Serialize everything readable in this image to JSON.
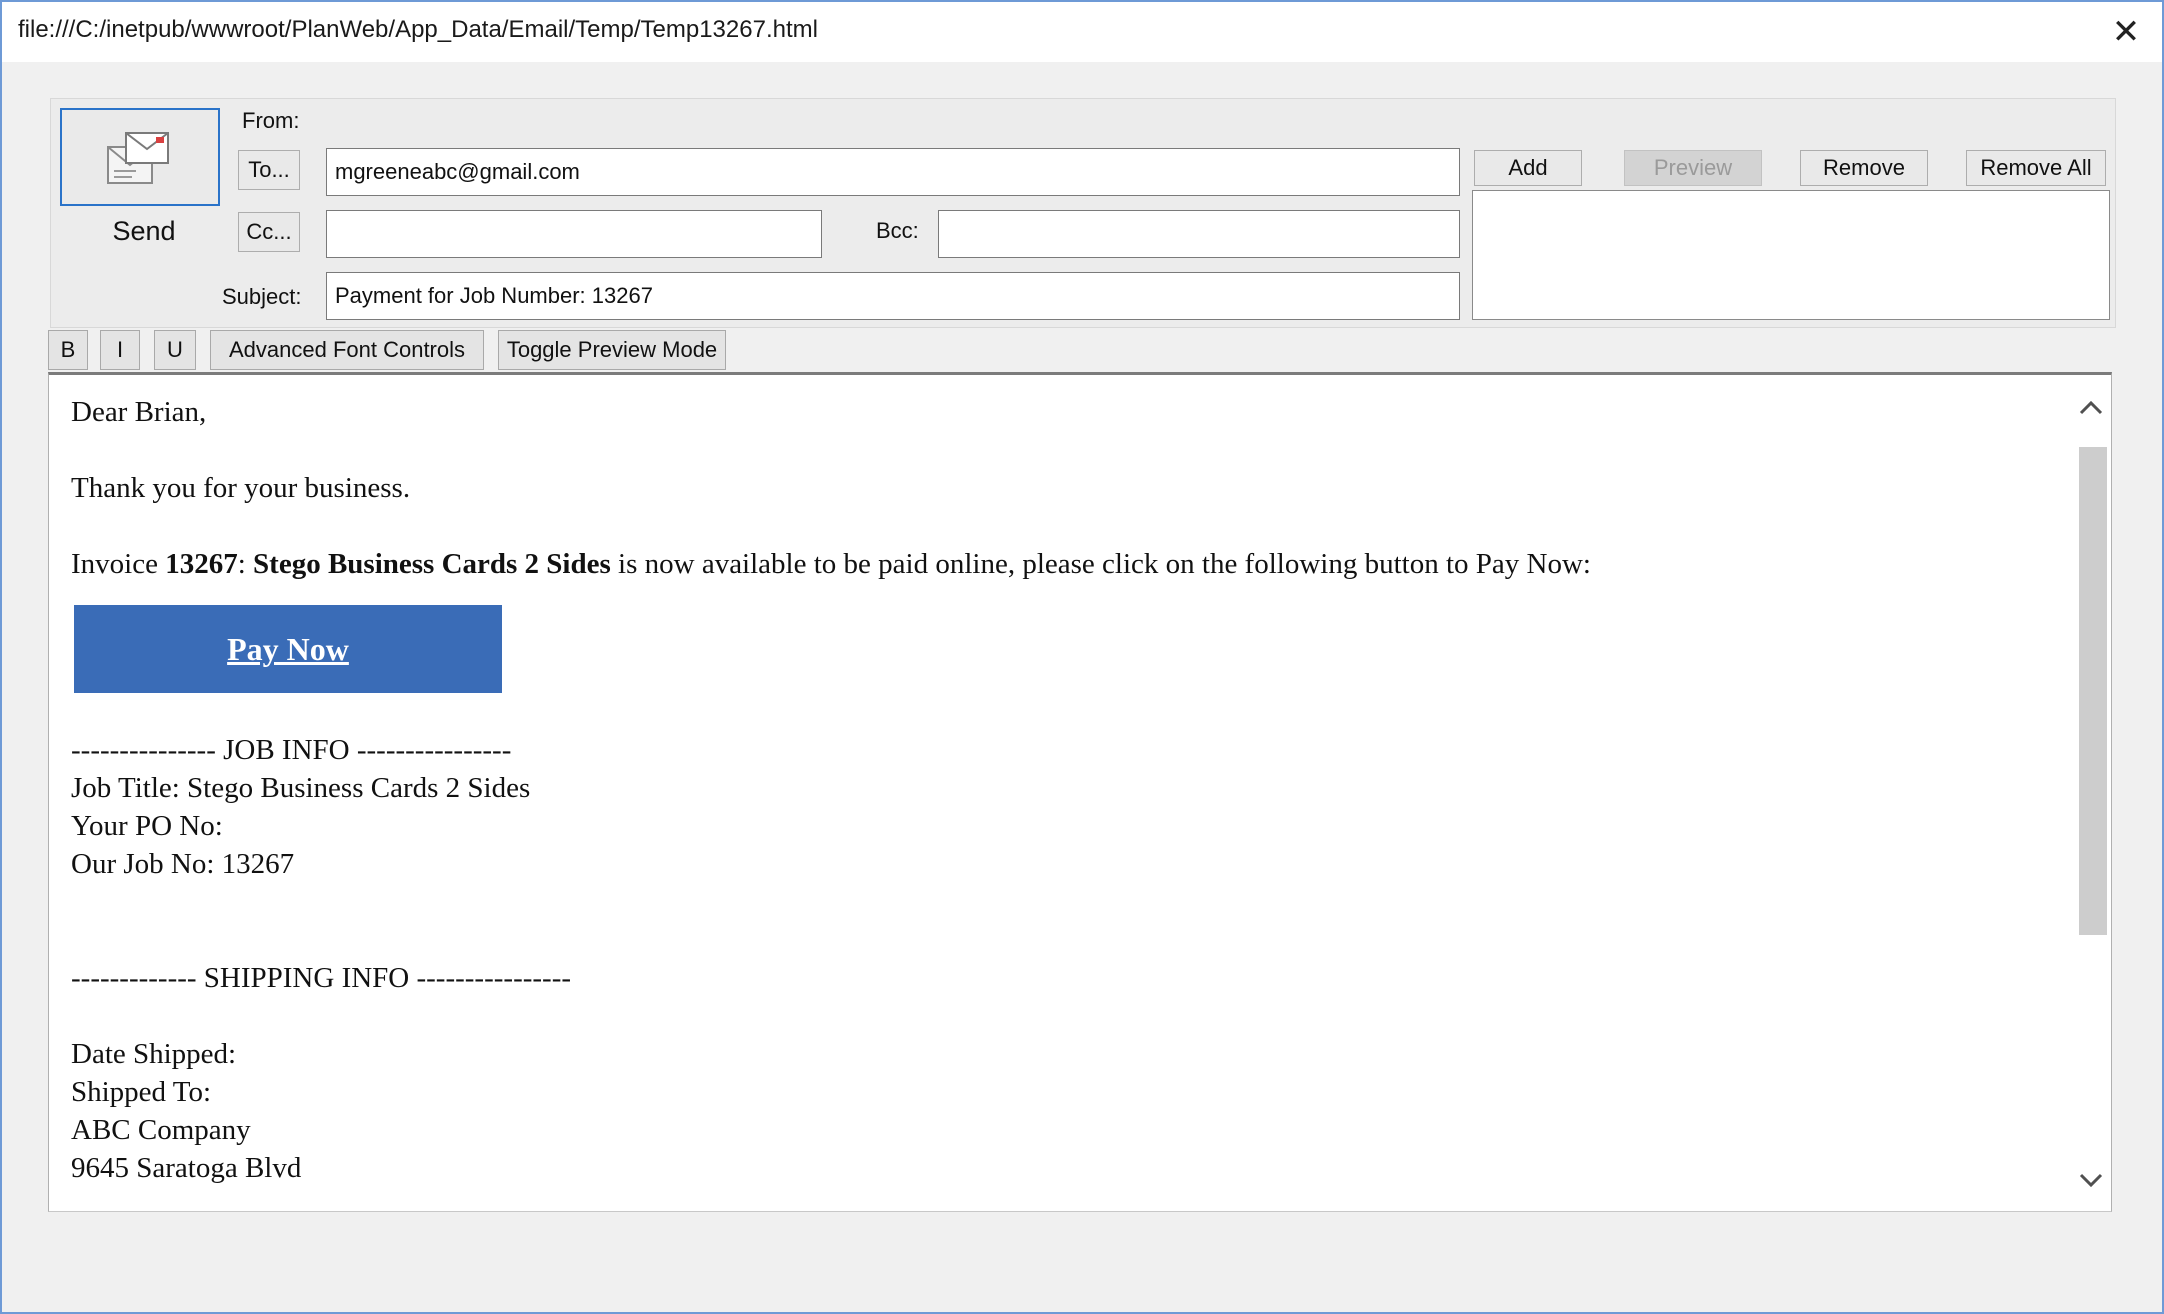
{
  "window": {
    "title": "file:///C:/inetpub/wwwroot/PlanWeb/App_Data/Email/Temp/Temp13267.html",
    "close_glyph": "✕"
  },
  "compose": {
    "send_label": "Send",
    "from_label": "From:",
    "to_button": "To...",
    "cc_button": "Cc...",
    "bcc_label": "Bcc:",
    "subject_label": "Subject:",
    "to_value": "mgreeneabc@gmail.com",
    "cc_value": "",
    "bcc_value": "",
    "subject_value": "Payment for Job Number: 13267"
  },
  "attachments": {
    "add": "Add",
    "preview": "Preview",
    "remove": "Remove",
    "remove_all": "Remove All",
    "items": []
  },
  "format_toolbar": {
    "bold": "B",
    "italic": "I",
    "underline": "U",
    "advanced": "Advanced Font Controls",
    "toggle_preview": "Toggle Preview Mode"
  },
  "email": {
    "greeting": "Dear Brian,",
    "thanks": "Thank you for your business.",
    "invoice_prefix": "Invoice ",
    "invoice_number": "13267",
    "invoice_sep": ": ",
    "job_name": "Stego Business Cards 2 Sides",
    "invoice_suffix": " is now available to be paid online, please click on the following button to Pay Now:",
    "pay_now": "Pay Now",
    "job_info_header": "--------------- JOB INFO ----------------",
    "job_title": "Job Title: Stego Business Cards 2 Sides",
    "po_no": "Your PO No:",
    "job_no": "Our Job No: 13267",
    "shipping_header": "------------- SHIPPING INFO ----------------",
    "date_shipped": "Date Shipped:",
    "shipped_to": "Shipped To:",
    "company": "ABC Company",
    "address": "9645 Saratoga Blvd"
  },
  "colors": {
    "pay_button": "#3a6cb7",
    "send_border": "#2a73c9"
  },
  "icons": {
    "send": "send-mail-icon",
    "scroll_up": "chevron-up-icon",
    "scroll_down": "chevron-down-icon"
  }
}
